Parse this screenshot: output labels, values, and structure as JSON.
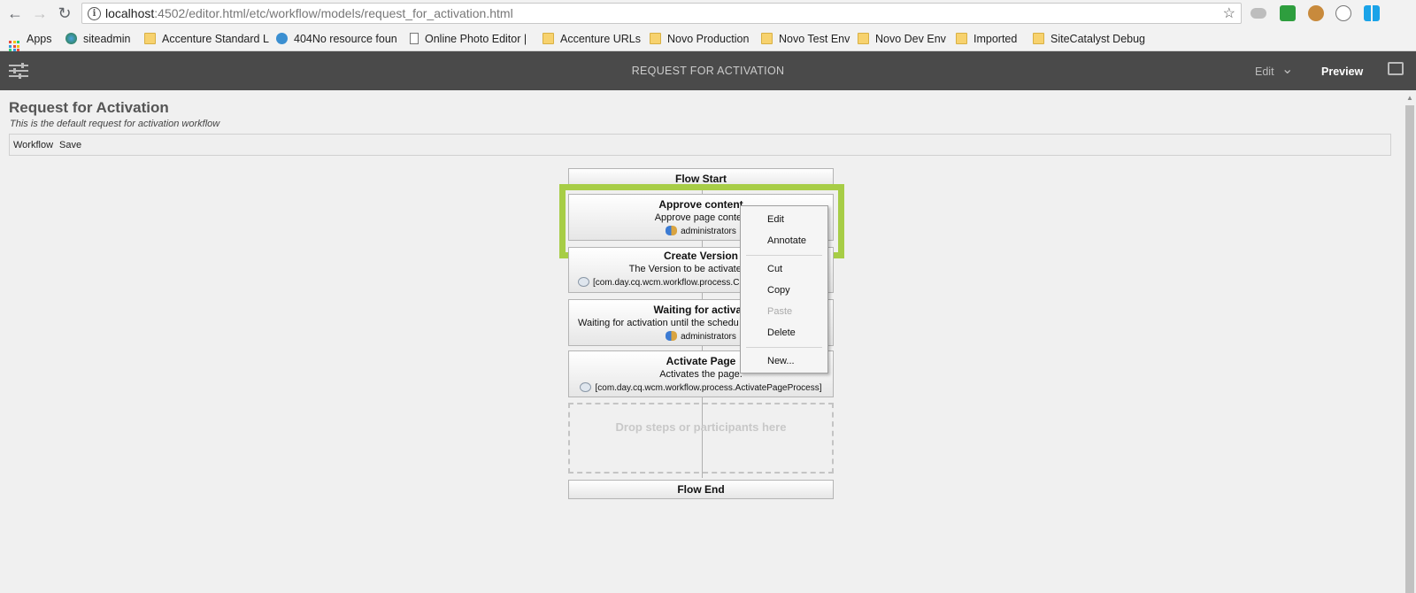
{
  "browser": {
    "url_host": "localhost",
    "url_rest": ":4502/editor.html/etc/workflow/models/request_for_activation.html",
    "bookmarks": [
      {
        "label": "Apps",
        "icon": "apps-grid-icon"
      },
      {
        "label": "siteadmin",
        "icon": "globe-icon"
      },
      {
        "label": "Accenture Standard L",
        "icon": "folder-icon"
      },
      {
        "label": "404No resource foun",
        "icon": "gear-cog-icon"
      },
      {
        "label": "Online Photo Editor |",
        "icon": "page-icon"
      },
      {
        "label": "Accenture URLs",
        "icon": "folder-icon"
      },
      {
        "label": "Novo Production",
        "icon": "folder-icon"
      },
      {
        "label": "Novo Test Env",
        "icon": "folder-icon"
      },
      {
        "label": "Novo Dev Env",
        "icon": "folder-icon"
      },
      {
        "label": "Imported",
        "icon": "folder-icon"
      },
      {
        "label": "SiteCatalyst Debug",
        "icon": "folder-icon"
      }
    ]
  },
  "toolbar": {
    "title": "REQUEST FOR ACTIVATION",
    "mode": "Edit",
    "preview": "Preview"
  },
  "model": {
    "title": "Request for Activation",
    "description": "This is the default request for activation workflow",
    "menu": [
      "Workflow",
      "Save"
    ]
  },
  "steps": {
    "flow_start": "Flow Start",
    "approve": {
      "title": "Approve content",
      "desc": "Approve page conten",
      "participant": "administrators"
    },
    "version": {
      "title": "Create Version",
      "desc": "The Version to be activated/replic",
      "process": "[com.day.cq.wcm.workflow.process.C"
    },
    "waiting": {
      "title": "Waiting for activati",
      "desc": "Waiting for activation until the schedu",
      "participant": "administrators"
    },
    "activate": {
      "title": "Activate Page",
      "desc": "Activates the page.",
      "process": "[com.day.cq.wcm.workflow.process.ActivatePageProcess]"
    },
    "dropzone": "Drop steps or participants here",
    "flow_end": "Flow End"
  },
  "context_menu": {
    "edit": "Edit",
    "annotate": "Annotate",
    "cut": "Cut",
    "copy": "Copy",
    "paste": "Paste",
    "delete": "Delete",
    "new": "New..."
  },
  "colors": {
    "highlight": "#a7cd46",
    "toolbar_bg": "#4a4a4a"
  }
}
